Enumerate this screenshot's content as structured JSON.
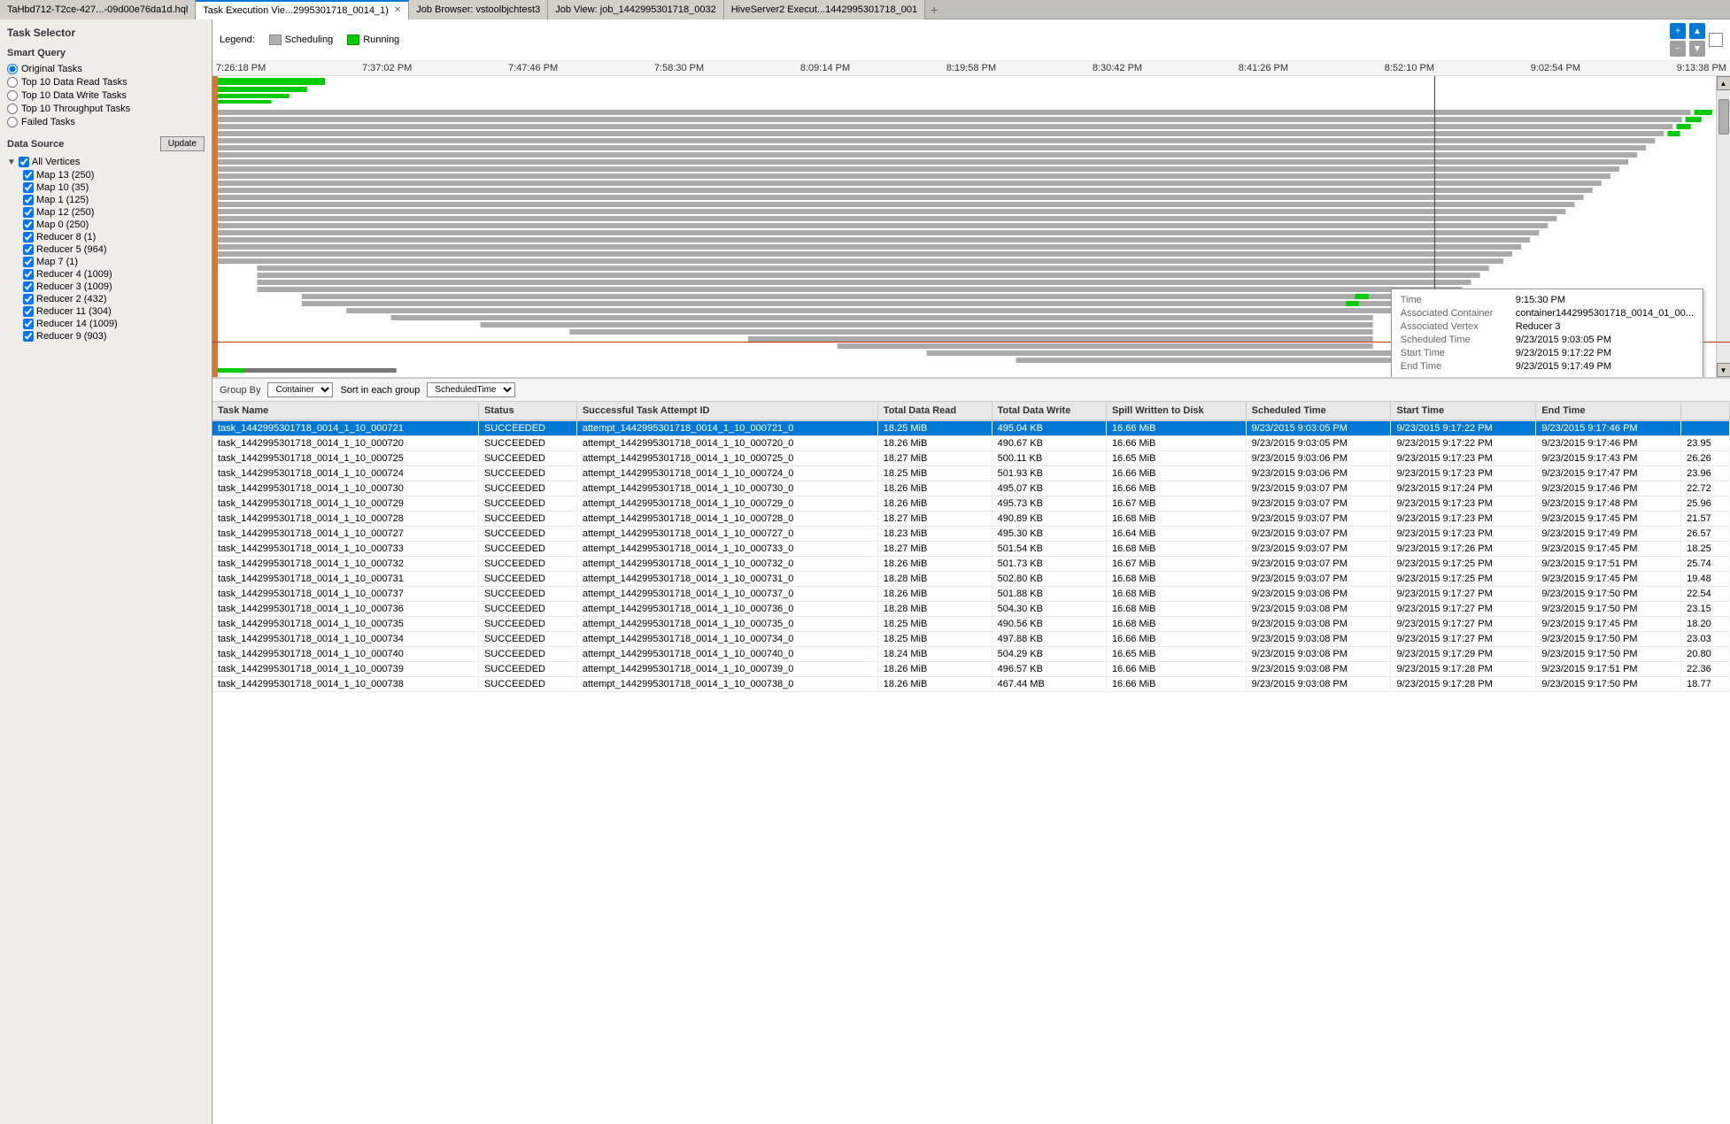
{
  "tabs": [
    {
      "id": "tab-hql",
      "label": "TaHbd712-T2ce-427...-09d00e76da1d.hql",
      "active": false,
      "closable": false
    },
    {
      "id": "tab-execution",
      "label": "Task Execution Vie...2995301718_0014_1)",
      "active": true,
      "closable": true
    },
    {
      "id": "tab-job-browser",
      "label": "Job Browser: vstoolbjchtest3",
      "active": false,
      "closable": false
    },
    {
      "id": "tab-job-view",
      "label": "Job View: job_1442995301718_0032",
      "active": false,
      "closable": false
    },
    {
      "id": "tab-hive-server",
      "label": "HiveServer2 Execut...1442995301718_001",
      "active": false,
      "closable": false
    }
  ],
  "sidebar": {
    "title": "Task Selector",
    "smart_query_label": "Smart Query",
    "options": [
      {
        "id": "opt-original",
        "label": "Original Tasks",
        "checked": true
      },
      {
        "id": "opt-top10-read",
        "label": "Top 10 Data Read Tasks",
        "checked": false
      },
      {
        "id": "opt-top10-write",
        "label": "Top 10 Data Write Tasks",
        "checked": false
      },
      {
        "id": "opt-top10-throughput",
        "label": "Top 10 Throughput Tasks",
        "checked": false
      },
      {
        "id": "opt-failed",
        "label": "Failed Tasks",
        "checked": false
      }
    ],
    "data_source_label": "Data Source",
    "update_button": "Update",
    "vertices": {
      "all_label": "All Vertices",
      "items": [
        {
          "label": "Map 13 (250)",
          "checked": true
        },
        {
          "label": "Map 10 (35)",
          "checked": true
        },
        {
          "label": "Map 1 (125)",
          "checked": true
        },
        {
          "label": "Map 12 (250)",
          "checked": true
        },
        {
          "label": "Map 0 (250)",
          "checked": true
        },
        {
          "label": "Reducer 8 (1)",
          "checked": true
        },
        {
          "label": "Reducer 5 (964)",
          "checked": true
        },
        {
          "label": "Map 7 (1)",
          "checked": true
        },
        {
          "label": "Reducer 4 (1009)",
          "checked": true
        },
        {
          "label": "Reducer 3 (1009)",
          "checked": true
        },
        {
          "label": "Reducer 2 (432)",
          "checked": true
        },
        {
          "label": "Reducer 11 (304)",
          "checked": true
        },
        {
          "label": "Reducer 14 (1009)",
          "checked": true
        },
        {
          "label": "Reducer 9 (903)",
          "checked": true
        }
      ]
    }
  },
  "legend": {
    "label": "Legend:",
    "items": [
      {
        "label": "Scheduling",
        "color": "#b0b0b0"
      },
      {
        "label": "Running",
        "color": "#00cc00"
      }
    ]
  },
  "timeline": {
    "times": [
      "7:26:18 PM",
      "7:37:02 PM",
      "7:47:46 PM",
      "7:58:30 PM",
      "8:09:14 PM",
      "8:19:58 PM",
      "8:30:42 PM",
      "8:41:26 PM",
      "8:52:10 PM",
      "9:02:54 PM",
      "9:13:38 PM"
    ]
  },
  "controls": {
    "group_by_label": "Group By",
    "group_by_value": "Container",
    "sort_label": "Sort in each group",
    "sort_value": "ScheduledTime"
  },
  "tooltip": {
    "time_label": "Time",
    "time_value": "9:15:30 PM",
    "container_label": "Associated Container",
    "container_value": "container1442995301718_0014_01_00...",
    "vertex_label": "Associated Vertex",
    "vertex_value": "Reducer 3",
    "scheduled_label": "Scheduled Time",
    "scheduled_value": "9/23/2015 9:03:05 PM",
    "start_label": "Start Time",
    "start_value": "9/23/2015 9:17:22 PM",
    "end_label": "End Time",
    "end_value": "9/23/2015 9:17:49 PM"
  },
  "table": {
    "headers": [
      "Task Name",
      "Status",
      "Successful Task Attempt ID",
      "Total Data Read",
      "Total Data Write",
      "Spill Written to Disk",
      "Scheduled Time",
      "Start Time",
      "End Time",
      ""
    ],
    "rows": [
      {
        "selected": true,
        "task": "task_1442995301718_0014_1_10_000721",
        "status": "SUCCEEDED",
        "attempt": "attempt_1442995301718_0014_1_10_000721_0",
        "read": "18.25 MiB",
        "write": "495.04 KB",
        "spill": "16.66 MiB",
        "scheduled": "9/23/2015 9:03:05 PM",
        "start": "9/23/2015 9:17:22 PM",
        "end": "9/23/2015 9:17:46 PM",
        "duration": ""
      },
      {
        "selected": false,
        "task": "task_1442995301718_0014_1_10_000720",
        "status": "SUCCEEDED",
        "attempt": "attempt_1442995301718_0014_1_10_000720_0",
        "read": "18.26 MiB",
        "write": "490.67 KB",
        "spill": "16.66 MiB",
        "scheduled": "9/23/2015 9:03:05 PM",
        "start": "9/23/2015 9:17:22 PM",
        "end": "9/23/2015 9:17:46 PM",
        "duration": "23.95"
      },
      {
        "selected": false,
        "task": "task_1442995301718_0014_1_10_000725",
        "status": "SUCCEEDED",
        "attempt": "attempt_1442995301718_0014_1_10_000725_0",
        "read": "18.27 MiB",
        "write": "500.11 KB",
        "spill": "16.65 MiB",
        "scheduled": "9/23/2015 9:03:06 PM",
        "start": "9/23/2015 9:17:23 PM",
        "end": "9/23/2015 9:17:43 PM",
        "duration": "26.26"
      },
      {
        "selected": false,
        "task": "task_1442995301718_0014_1_10_000724",
        "status": "SUCCEEDED",
        "attempt": "attempt_1442995301718_0014_1_10_000724_0",
        "read": "18.25 MiB",
        "write": "501.93 KB",
        "spill": "16.66 MiB",
        "scheduled": "9/23/2015 9:03:06 PM",
        "start": "9/23/2015 9:17:23 PM",
        "end": "9/23/2015 9:17:47 PM",
        "duration": "23.96"
      },
      {
        "selected": false,
        "task": "task_1442995301718_0014_1_10_000730",
        "status": "SUCCEEDED",
        "attempt": "attempt_1442995301718_0014_1_10_000730_0",
        "read": "18.26 MiB",
        "write": "495.07 KB",
        "spill": "16.66 MiB",
        "scheduled": "9/23/2015 9:03:07 PM",
        "start": "9/23/2015 9:17:24 PM",
        "end": "9/23/2015 9:17:46 PM",
        "duration": "22.72"
      },
      {
        "selected": false,
        "task": "task_1442995301718_0014_1_10_000729",
        "status": "SUCCEEDED",
        "attempt": "attempt_1442995301718_0014_1_10_000729_0",
        "read": "18.26 MiB",
        "write": "495.73 KB",
        "spill": "16.67 MiB",
        "scheduled": "9/23/2015 9:03:07 PM",
        "start": "9/23/2015 9:17:23 PM",
        "end": "9/23/2015 9:17:48 PM",
        "duration": "25.96"
      },
      {
        "selected": false,
        "task": "task_1442995301718_0014_1_10_000728",
        "status": "SUCCEEDED",
        "attempt": "attempt_1442995301718_0014_1_10_000728_0",
        "read": "18.27 MiB",
        "write": "490.89 KB",
        "spill": "16.68 MiB",
        "scheduled": "9/23/2015 9:03:07 PM",
        "start": "9/23/2015 9:17:23 PM",
        "end": "9/23/2015 9:17:45 PM",
        "duration": "21.57"
      },
      {
        "selected": false,
        "task": "task_1442995301718_0014_1_10_000727",
        "status": "SUCCEEDED",
        "attempt": "attempt_1442995301718_0014_1_10_000727_0",
        "read": "18.23 MiB",
        "write": "495.30 KB",
        "spill": "16.64 MiB",
        "scheduled": "9/23/2015 9:03:07 PM",
        "start": "9/23/2015 9:17:23 PM",
        "end": "9/23/2015 9:17:49 PM",
        "duration": "26.57"
      },
      {
        "selected": false,
        "task": "task_1442995301718_0014_1_10_000733",
        "status": "SUCCEEDED",
        "attempt": "attempt_1442995301718_0014_1_10_000733_0",
        "read": "18.27 MiB",
        "write": "501.54 KB",
        "spill": "16.68 MiB",
        "scheduled": "9/23/2015 9:03:07 PM",
        "start": "9/23/2015 9:17:26 PM",
        "end": "9/23/2015 9:17:45 PM",
        "duration": "18.25"
      },
      {
        "selected": false,
        "task": "task_1442995301718_0014_1_10_000732",
        "status": "SUCCEEDED",
        "attempt": "attempt_1442995301718_0014_1_10_000732_0",
        "read": "18.26 MiB",
        "write": "501.73 KB",
        "spill": "16.67 MiB",
        "scheduled": "9/23/2015 9:03:07 PM",
        "start": "9/23/2015 9:17:25 PM",
        "end": "9/23/2015 9:17:51 PM",
        "duration": "25.74"
      },
      {
        "selected": false,
        "task": "task_1442995301718_0014_1_10_000731",
        "status": "SUCCEEDED",
        "attempt": "attempt_1442995301718_0014_1_10_000731_0",
        "read": "18.28 MiB",
        "write": "502.80 KB",
        "spill": "16.68 MiB",
        "scheduled": "9/23/2015 9:03:07 PM",
        "start": "9/23/2015 9:17:25 PM",
        "end": "9/23/2015 9:17:45 PM",
        "duration": "19.48"
      },
      {
        "selected": false,
        "task": "task_1442995301718_0014_1_10_000737",
        "status": "SUCCEEDED",
        "attempt": "attempt_1442995301718_0014_1_10_000737_0",
        "read": "18.26 MiB",
        "write": "501.88 KB",
        "spill": "16.68 MiB",
        "scheduled": "9/23/2015 9:03:08 PM",
        "start": "9/23/2015 9:17:27 PM",
        "end": "9/23/2015 9:17:50 PM",
        "duration": "22.54"
      },
      {
        "selected": false,
        "task": "task_1442995301718_0014_1_10_000736",
        "status": "SUCCEEDED",
        "attempt": "attempt_1442995301718_0014_1_10_000736_0",
        "read": "18.28 MiB",
        "write": "504.30 KB",
        "spill": "16.68 MiB",
        "scheduled": "9/23/2015 9:03:08 PM",
        "start": "9/23/2015 9:17:27 PM",
        "end": "9/23/2015 9:17:50 PM",
        "duration": "23.15"
      },
      {
        "selected": false,
        "task": "task_1442995301718_0014_1_10_000735",
        "status": "SUCCEEDED",
        "attempt": "attempt_1442995301718_0014_1_10_000735_0",
        "read": "18.25 MiB",
        "write": "490.56 KB",
        "spill": "16.68 MiB",
        "scheduled": "9/23/2015 9:03:08 PM",
        "start": "9/23/2015 9:17:27 PM",
        "end": "9/23/2015 9:17:45 PM",
        "duration": "18.20"
      },
      {
        "selected": false,
        "task": "task_1442995301718_0014_1_10_000734",
        "status": "SUCCEEDED",
        "attempt": "attempt_1442995301718_0014_1_10_000734_0",
        "read": "18.25 MiB",
        "write": "497.88 KB",
        "spill": "16.66 MiB",
        "scheduled": "9/23/2015 9:03:08 PM",
        "start": "9/23/2015 9:17:27 PM",
        "end": "9/23/2015 9:17:50 PM",
        "duration": "23.03"
      },
      {
        "selected": false,
        "task": "task_1442995301718_0014_1_10_000740",
        "status": "SUCCEEDED",
        "attempt": "attempt_1442995301718_0014_1_10_000740_0",
        "read": "18.24 MiB",
        "write": "504.29 KB",
        "spill": "16.65 MiB",
        "scheduled": "9/23/2015 9:03:08 PM",
        "start": "9/23/2015 9:17:29 PM",
        "end": "9/23/2015 9:17:50 PM",
        "duration": "20.80"
      },
      {
        "selected": false,
        "task": "task_1442995301718_0014_1_10_000739",
        "status": "SUCCEEDED",
        "attempt": "attempt_1442995301718_0014_1_10_000739_0",
        "read": "18.26 MiB",
        "write": "496.57 KB",
        "spill": "16.66 MiB",
        "scheduled": "9/23/2015 9:03:08 PM",
        "start": "9/23/2015 9:17:28 PM",
        "end": "9/23/2015 9:17:51 PM",
        "duration": "22.36"
      },
      {
        "selected": false,
        "task": "task_1442995301718_0014_1_10_000738",
        "status": "SUCCEEDED",
        "attempt": "attempt_1442995301718_0014_1_10_000738_0",
        "read": "18.26 MiB",
        "write": "467.44 MB",
        "spill": "16.66 MiB",
        "scheduled": "9/23/2015 9:03:08 PM",
        "start": "9/23/2015 9:17:28 PM",
        "end": "9/23/2015 9:17:50 PM",
        "duration": "18.77"
      }
    ]
  }
}
